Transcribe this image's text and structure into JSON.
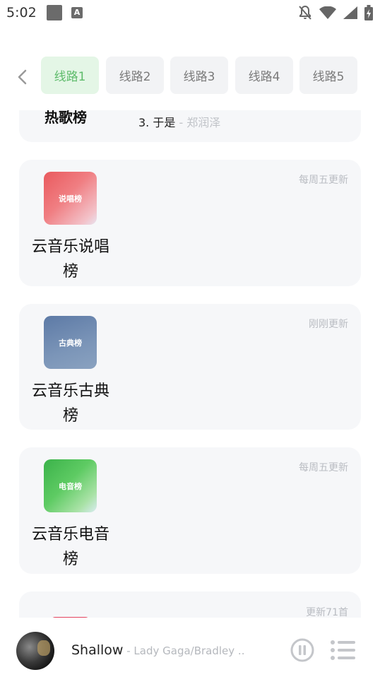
{
  "status_bar": {
    "time": "5:02"
  },
  "routes": {
    "tabs": [
      "线路1",
      "线路2",
      "线路3",
      "线路4",
      "线路5"
    ],
    "active_index": 0
  },
  "charts": {
    "partial_card": {
      "title": "热歌榜",
      "song_line": "3. 于是",
      "song_artist": " - 郑润泽"
    },
    "cards": [
      {
        "cover_label": "说唱榜",
        "title": "云音乐说唱榜",
        "update": "每周五更新"
      },
      {
        "cover_label": "古典榜",
        "title": "云音乐古典榜",
        "update": "刚刚更新"
      },
      {
        "cover_label": "电音榜",
        "title": "云音乐电音榜",
        "update": "每周五更新"
      }
    ],
    "bottom_partial_card": {
      "update": "更新71首"
    }
  },
  "player": {
    "title": "Shallow",
    "artist": " - Lady Gaga/Bradley ..."
  },
  "colors": {
    "accent": "#5dbb6a",
    "active_tab_bg": "#e4f6e6",
    "card_bg": "#f6f7f9"
  },
  "icons": {
    "status": [
      "notification-off-icon",
      "wifi-icon",
      "signal-icon",
      "battery-charging-icon"
    ],
    "back": "chevron-left-icon",
    "play": "pause-icon",
    "playlist": "playlist-icon"
  }
}
